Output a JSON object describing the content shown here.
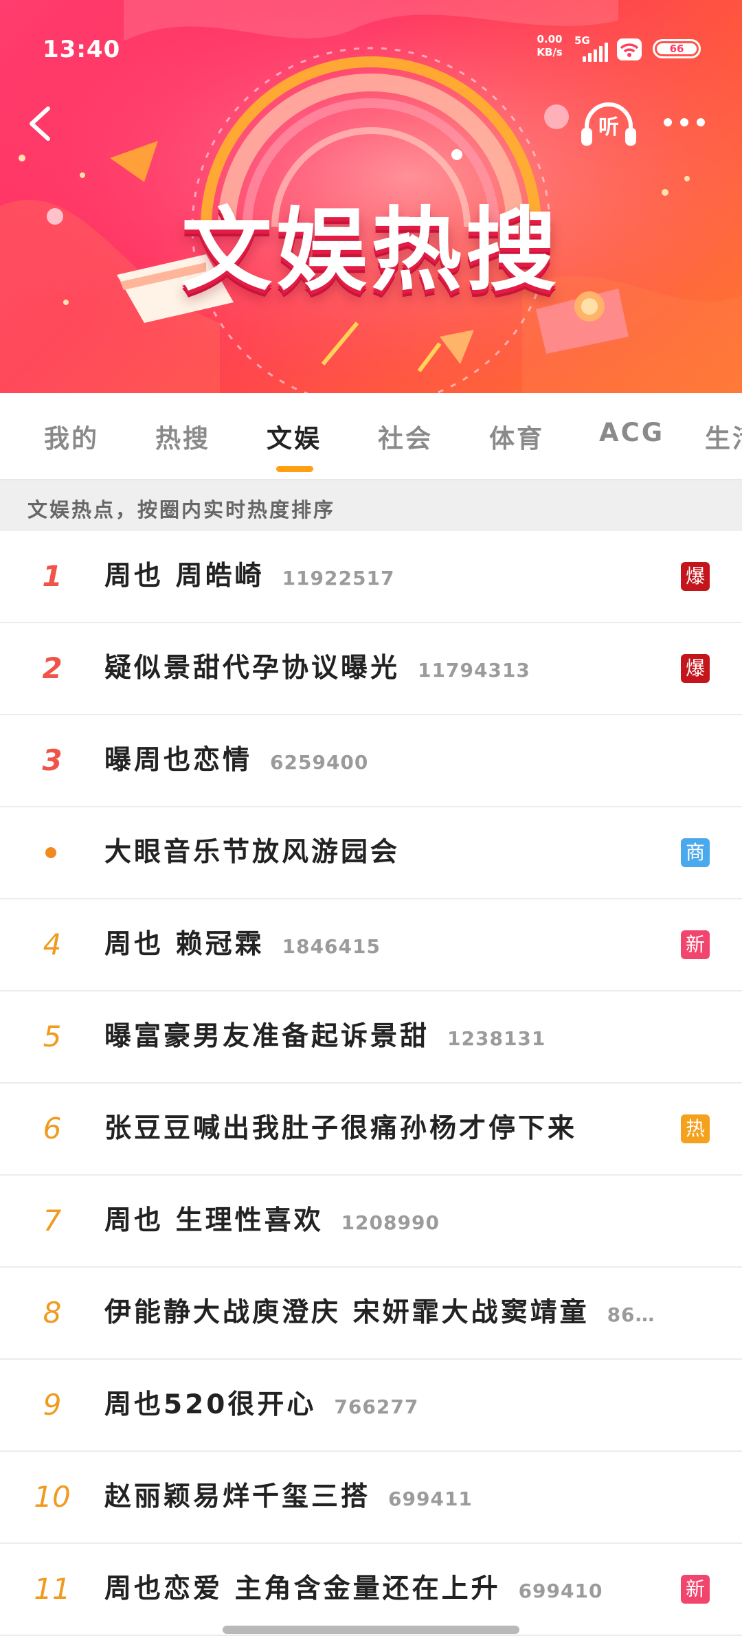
{
  "status": {
    "time": "13:40",
    "net_speed_value": "0.00",
    "net_speed_unit": "KB/s",
    "network_type": "5G",
    "battery_level": "66"
  },
  "header": {
    "banner_title": "文娱热搜",
    "listen_label": "听",
    "colors": {
      "primary": "#ff2f5c",
      "accent": "#ffb22c"
    }
  },
  "tabs": [
    {
      "label": "我的"
    },
    {
      "label": "热搜"
    },
    {
      "label": "文娱"
    },
    {
      "label": "社会"
    },
    {
      "label": "体育"
    },
    {
      "label": "ACG"
    },
    {
      "label": "生活"
    }
  ],
  "active_tab": "文娱",
  "subtitle": "文娱热点，按圈内实时热度排序",
  "items": [
    {
      "rank": "1",
      "title": "周也  周皓崎",
      "count": "11922517",
      "badge": "爆",
      "badge_color": "#c4151c"
    },
    {
      "rank": "2",
      "title": "疑似景甜代孕协议曝光",
      "count": "11794313",
      "badge": "爆",
      "badge_color": "#c4151c"
    },
    {
      "rank": "3",
      "title": "曝周也恋情",
      "count": "6259400",
      "badge": "",
      "badge_color": ""
    },
    {
      "rank": "•",
      "title": "大眼音乐节放风游园会",
      "count": "",
      "badge": "商",
      "badge_color": "#4aa8ec"
    },
    {
      "rank": "4",
      "title": "周也  赖冠霖",
      "count": "1846415",
      "badge": "新",
      "badge_color": "#f2456e"
    },
    {
      "rank": "5",
      "title": "曝富豪男友准备起诉景甜",
      "count": "1238131",
      "badge": "",
      "badge_color": ""
    },
    {
      "rank": "6",
      "title": "张豆豆喊出我肚子很痛孙杨才停下来",
      "count": "",
      "badge": "热",
      "badge_color": "#f4a11e"
    },
    {
      "rank": "7",
      "title": "周也  生理性喜欢",
      "count": "1208990",
      "badge": "",
      "badge_color": ""
    },
    {
      "rank": "8",
      "title": "伊能静大战庾澄庆  宋妍霏大战窦靖童",
      "count": "86…",
      "badge": "",
      "badge_color": ""
    },
    {
      "rank": "9",
      "title": "周也520很开心",
      "count": "766277",
      "badge": "",
      "badge_color": ""
    },
    {
      "rank": "10",
      "title": "赵丽颖易烊千玺三搭",
      "count": "699411",
      "badge": "",
      "badge_color": ""
    },
    {
      "rank": "11",
      "title": "周也恋爱  主角含金量还在上升",
      "count": "699410",
      "badge": "新",
      "badge_color": "#f2456e"
    }
  ]
}
